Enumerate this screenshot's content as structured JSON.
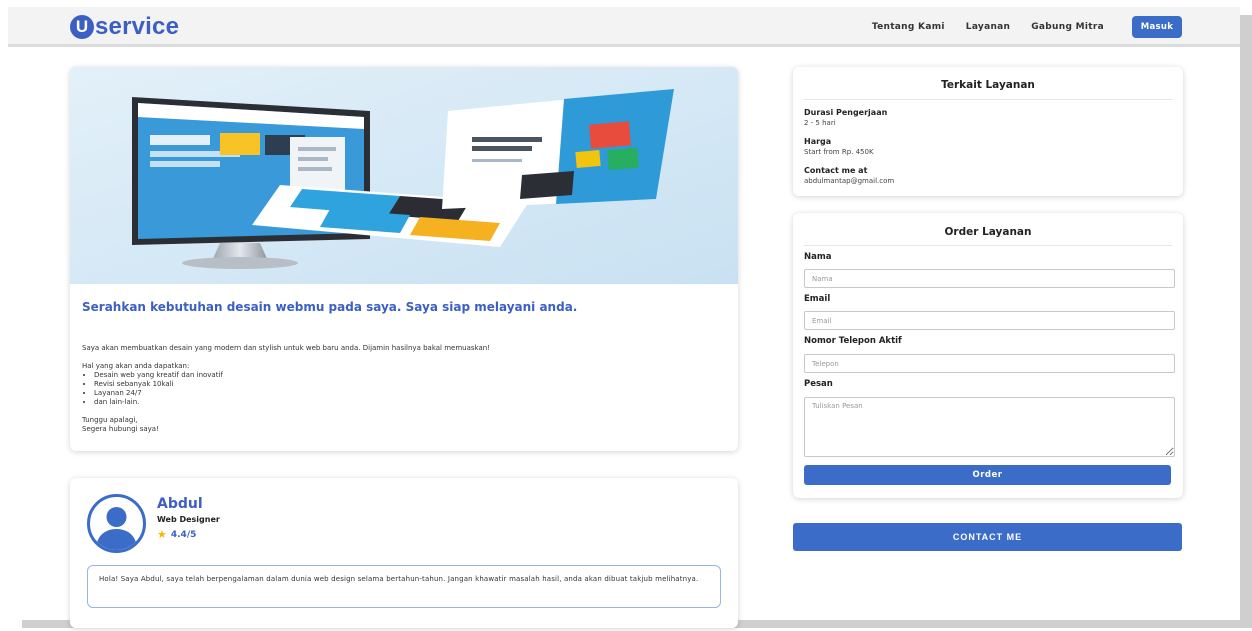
{
  "brand": {
    "logo_letter": "U",
    "logo_rest": "service",
    "accent_color": "#3b6cc7"
  },
  "nav": {
    "links": [
      "Tentang Kami",
      "Layanan",
      "Gabung Mitra"
    ],
    "login_label": "Masuk"
  },
  "service": {
    "title": "Serahkan kebutuhan desain webmu pada saya. Saya siap melayani anda.",
    "intro": "Saya akan membuatkan desain yang modern dan stylish untuk web baru anda. Dijamin hasilnya bakal memuaskan!",
    "benefits_heading": "Hal yang akan anda dapatkan:",
    "benefits": [
      "Desain web yang kreatif dan inovatif",
      "Revisi sebanyak 10kali",
      "Layanan 24/7",
      "dan lain-lain."
    ],
    "closing_1": "Tunggu apalagi,",
    "closing_2": "Segera hubungi saya!"
  },
  "profile": {
    "name": "Abdul",
    "role": "Web Designer",
    "rating": "4.4/5",
    "bio": "Hola! Saya Abdul, saya telah berpengalaman dalam dunia web design selama bertahun-tahun. Jangan khawatir masalah hasil, anda akan dibuat takjub melihatnya."
  },
  "info": {
    "title": "Terkait Layanan",
    "duration_label": "Durasi Pengerjaan",
    "duration_value": "2 - 5 hari",
    "price_label": "Harga",
    "price_value": "Start from Rp. 450K",
    "contact_label": "Contact me at",
    "contact_value": "abdulmantap@gmail.com"
  },
  "order": {
    "title": "Order Layanan",
    "name_label": "Nama",
    "name_placeholder": "Nama",
    "email_label": "Email",
    "email_placeholder": "Email",
    "phone_label": "Nomor Telepon Aktif",
    "phone_placeholder": "Telepon",
    "message_label": "Pesan",
    "message_placeholder": "Tuliskan Pesan",
    "submit_label": "Order"
  },
  "contact_button_label": "CONTACT ME"
}
